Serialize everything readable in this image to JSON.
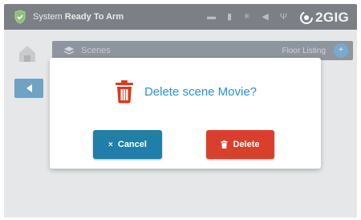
{
  "status_bar": {
    "prefix": "System",
    "state": "Ready To Arm",
    "icons": [
      "monitor-icon",
      "phone-icon",
      "sun-icon",
      "speaker-icon",
      "antenna-icon"
    ],
    "brand": "2GIG"
  },
  "background": {
    "scenes_label": "Scenes",
    "floor_label": "Floor Listing",
    "floor_button_glyph": "+"
  },
  "dialog": {
    "question": "Delete scene Movie?",
    "cancel_glyph": "×",
    "cancel_label": "Cancel",
    "delete_label": "Delete"
  },
  "colors": {
    "accent_blue": "#2b8fd6",
    "cancel_blue": "#1f7fa8",
    "delete_red": "#d9402b",
    "trash_red": "#e2361c"
  }
}
